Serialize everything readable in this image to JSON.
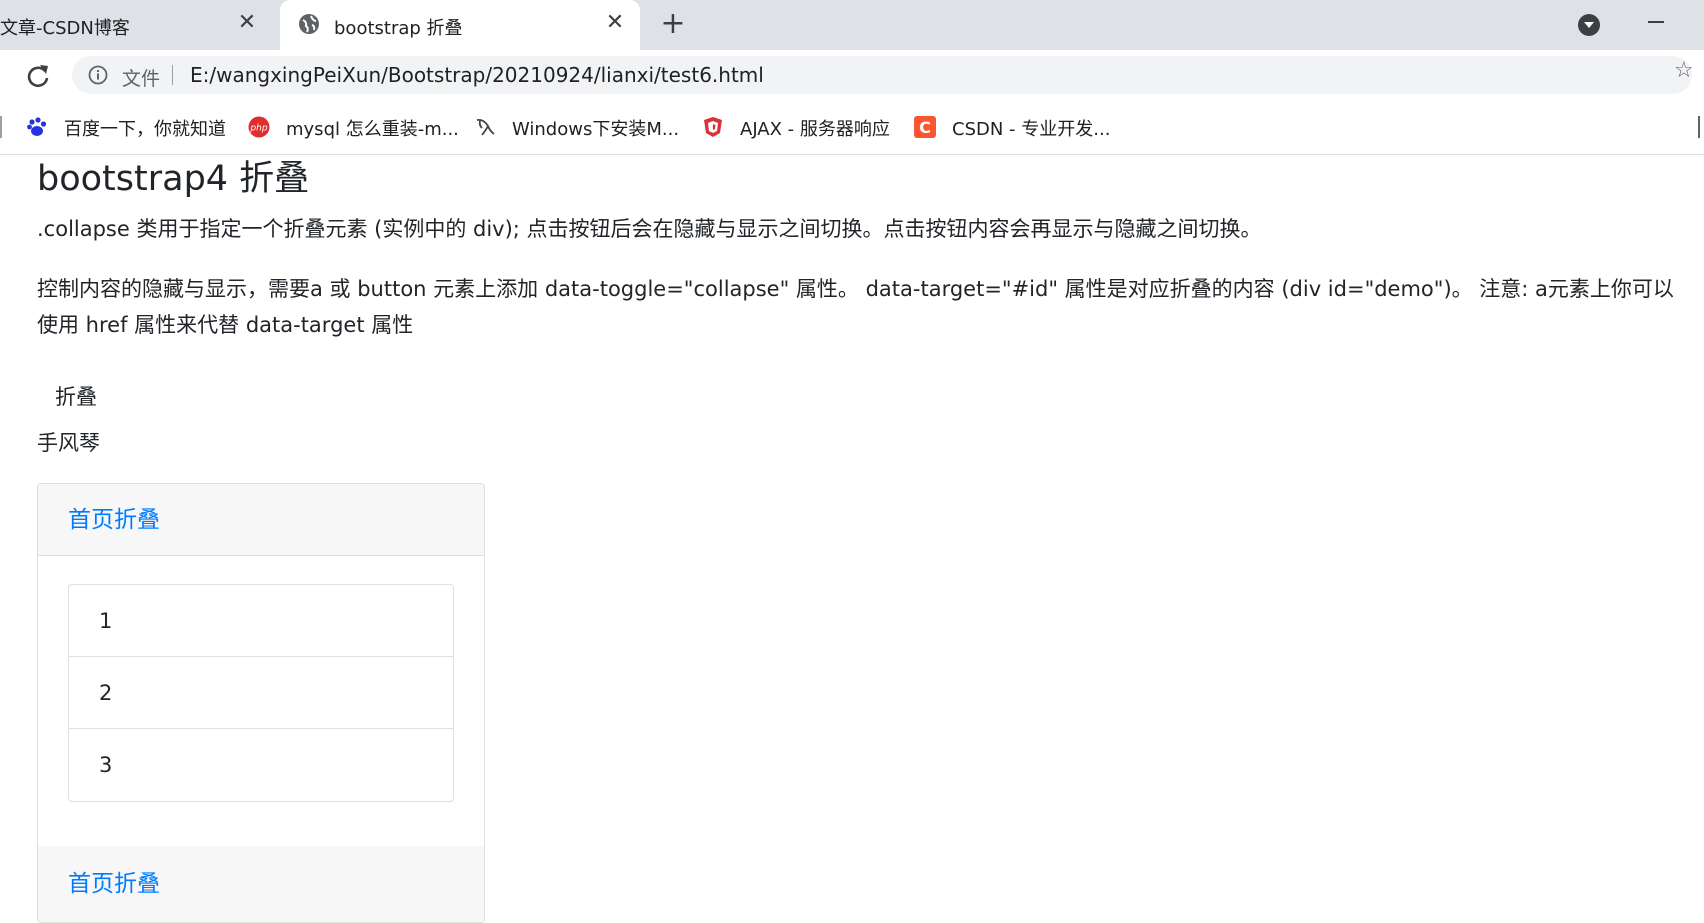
{
  "browser": {
    "tabs": [
      {
        "title": "文章-CSDN博客",
        "active": false
      },
      {
        "title": "bootstrap 折叠",
        "active": true
      }
    ],
    "new_tab_label": "+",
    "address": {
      "file_label": "文件",
      "url": "E:/wangxingPeiXun/Bootstrap/20210924/lianxi/test6.html"
    },
    "bookmarks": [
      {
        "label": "百度一下，你就知道",
        "icon": "baidu-paw-icon"
      },
      {
        "label": "mysql 怎么重装-m...",
        "icon": "php-icon"
      },
      {
        "label": "Windows下安装M...",
        "icon": "mysql-dolphin-icon"
      },
      {
        "label": "AJAX - 服务器响应",
        "icon": "w3-shield-icon"
      },
      {
        "label": "CSDN - 专业开发...",
        "icon": "csdn-icon"
      }
    ]
  },
  "page": {
    "heading": "bootstrap4 折叠",
    "paragraph1": ".collapse 类用于指定一个折叠元素 (实例中的 div); 点击按钮后会在隐藏与显示之间切换。点击按钮内容会再显示与隐藏之间切换。",
    "paragraph2": "控制内容的隐藏与显示，需要a 或 button 元素上添加 data-toggle=\"collapse\" 属性。  data-target=\"#id\" 属性是对应折叠的内容 (div id=\"demo\")。 注意: a元素上你可以使用 href 属性来代替 data-target 属性",
    "collapse_button": "折叠",
    "accordion_label": "手风琴",
    "card": {
      "header_link": "首页折叠",
      "list_items": [
        "1",
        "2",
        "3"
      ],
      "footer_link": "首页折叠"
    }
  },
  "colors": {
    "link": "#007bff",
    "tabstrip": "#dee1e6",
    "card_header": "#f7f7f7"
  }
}
